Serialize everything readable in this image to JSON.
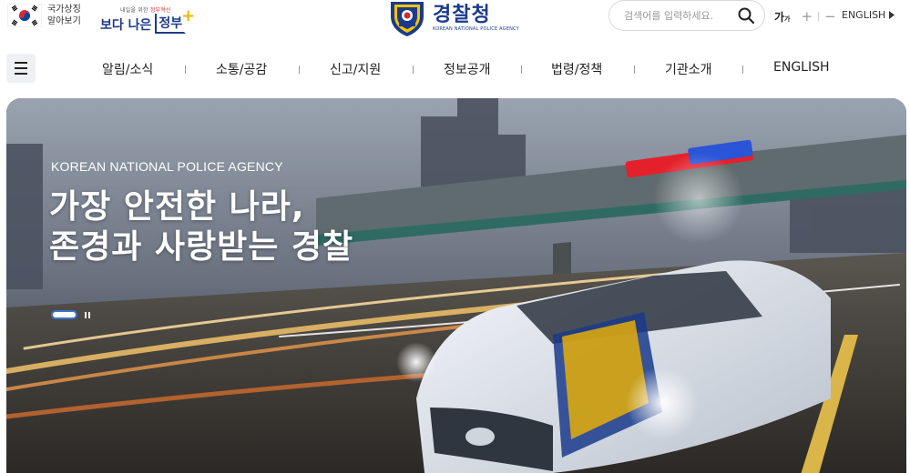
{
  "header": {
    "flag_text_line1": "국가상징",
    "flag_text_line2": "알아보기",
    "slogan_small_prefix": "내일을 위한",
    "slogan_small_accent": "정부혁신",
    "slogan_big_1": "보다 나은",
    "slogan_big_2": "정부",
    "logo_title": "경찰청",
    "logo_subtitle": "KOREAN NATIONAL POLICE AGENCY",
    "search_placeholder": "검색어를 입력하세요.",
    "font_label": "가",
    "font_label_small": "가",
    "font_increase": "+",
    "font_decrease": "−",
    "english_link": "ENGLISH"
  },
  "gnb": {
    "items": [
      "알림/소식",
      "소통/공감",
      "신고/지원",
      "정보공개",
      "법령/정책",
      "기관소개",
      "ENGLISH"
    ]
  },
  "hero": {
    "subtitle": "KOREAN NATIONAL POLICE AGENCY",
    "title_line1": "가장 안전한 나라,",
    "title_line2": "존경과 사랑받는 경찰"
  },
  "colors": {
    "brand_navy": "#1a3b8c",
    "slide_indicator": "#3d72c9",
    "accent_yellow": "#f0b400"
  },
  "icons": [
    "taegukgi-flag-icon",
    "police-emblem-icon",
    "search-icon",
    "menu-icon",
    "pause-icon",
    "chevron-right-icon"
  ]
}
